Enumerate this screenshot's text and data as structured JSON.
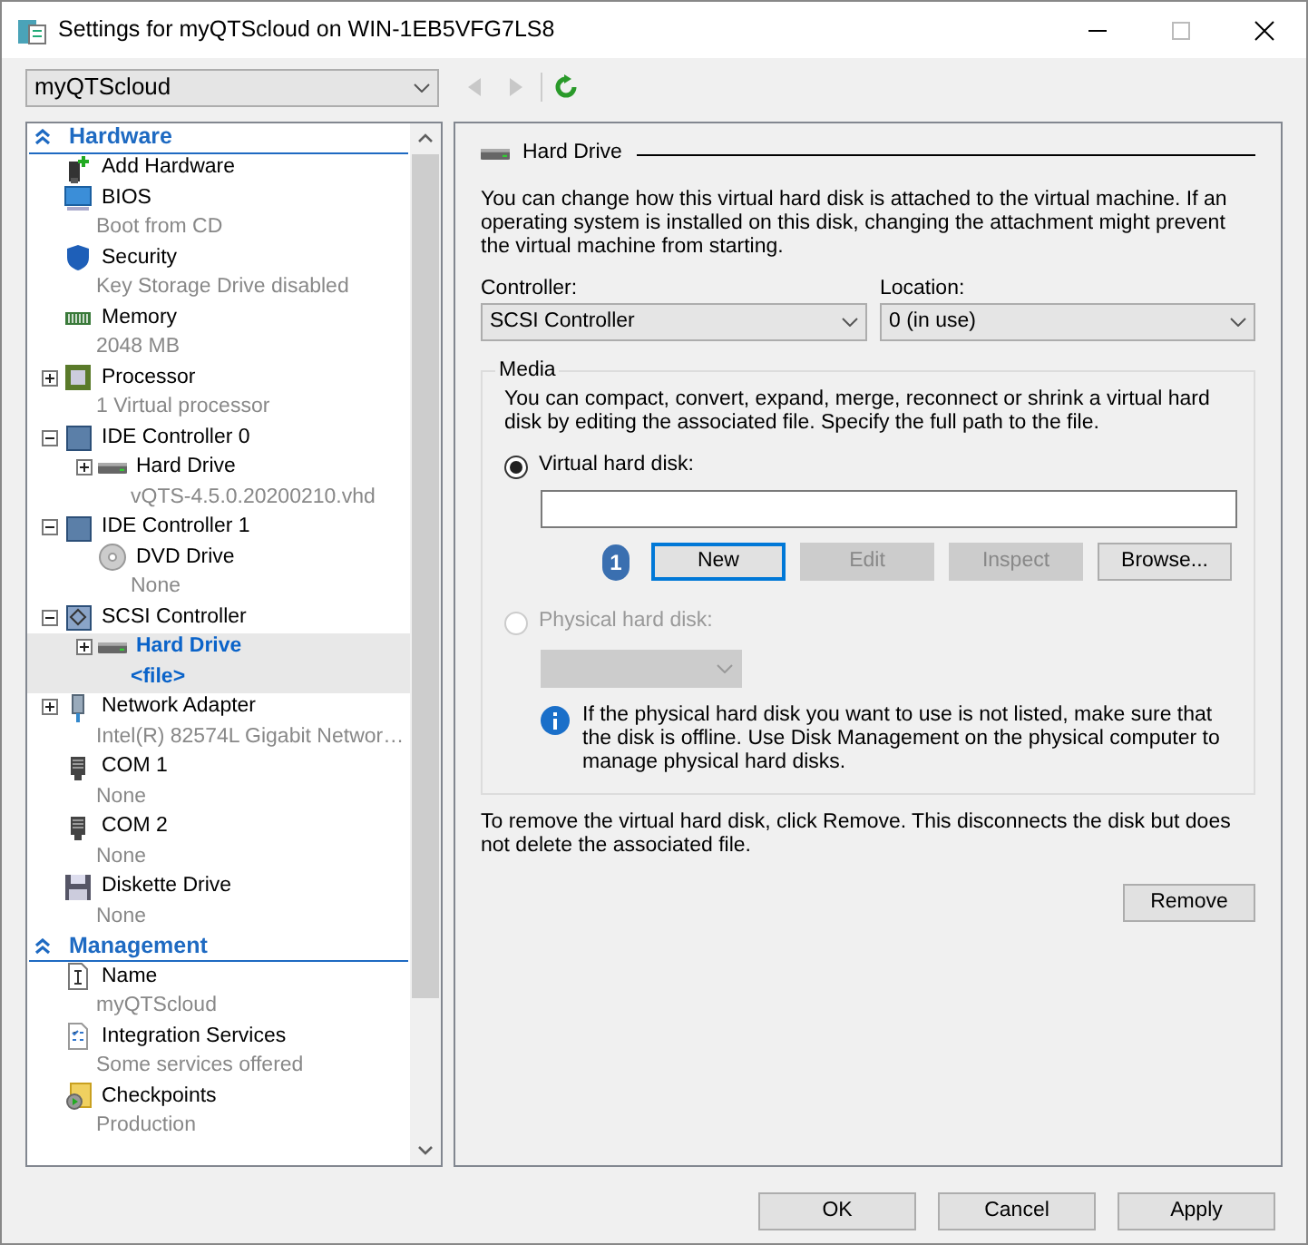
{
  "window": {
    "title": "Settings for myQTScloud on WIN-1EB5VFG7LS8"
  },
  "vm_selector": {
    "value": "myQTScloud"
  },
  "sections": [
    {
      "title": "Hardware",
      "expanded": true,
      "items": [
        {
          "kind": "add-hardware",
          "label": "Add Hardware",
          "selected": false
        },
        {
          "kind": "bios",
          "label": "BIOS",
          "detail": "Boot from CD",
          "selected": false
        },
        {
          "kind": "security",
          "label": "Security",
          "detail": "Key Storage Drive disabled",
          "selected": false
        },
        {
          "kind": "memory",
          "label": "Memory",
          "detail": "2048 MB",
          "selected": false
        },
        {
          "kind": "processor",
          "label": "Processor",
          "detail": "1 Virtual processor",
          "expanded": false,
          "selected": false
        },
        {
          "kind": "ide",
          "label": "IDE Controller 0",
          "expanded": true,
          "selected": false,
          "children": [
            {
              "kind": "hard-drive",
              "label": "Hard Drive",
              "detail": "vQTS-4.5.0.20200210.vhd",
              "expanded": false,
              "selected": false
            }
          ]
        },
        {
          "kind": "ide",
          "label": "IDE Controller 1",
          "expanded": true,
          "selected": false,
          "children": [
            {
              "kind": "dvd",
              "label": "DVD Drive",
              "detail": "None",
              "selected": false
            }
          ]
        },
        {
          "kind": "scsi",
          "label": "SCSI Controller",
          "expanded": true,
          "selected": false,
          "children": [
            {
              "kind": "hard-drive",
              "label": "Hard Drive",
              "detail": "<file>",
              "expanded": false,
              "selected": true
            }
          ]
        },
        {
          "kind": "network",
          "label": "Network Adapter",
          "detail": "Intel(R) 82574L Gigabit Networ…",
          "expanded": false,
          "selected": false
        },
        {
          "kind": "com",
          "label": "COM 1",
          "detail": "None",
          "selected": false
        },
        {
          "kind": "com",
          "label": "COM 2",
          "detail": "None",
          "selected": false
        },
        {
          "kind": "diskette",
          "label": "Diskette Drive",
          "detail": "None",
          "selected": false
        }
      ]
    },
    {
      "title": "Management",
      "expanded": true,
      "items": [
        {
          "kind": "name",
          "label": "Name",
          "detail": "myQTScloud",
          "selected": false
        },
        {
          "kind": "integration",
          "label": "Integration Services",
          "detail": "Some services offered",
          "selected": false
        },
        {
          "kind": "checkpoints",
          "label": "Checkpoints",
          "detail": "Production",
          "selected": false
        }
      ]
    }
  ],
  "panel": {
    "title": "Hard Drive",
    "description": "You can change how this virtual hard disk is attached to the virtual machine. If an operating system is installed on this disk, changing the attachment might prevent the virtual machine from starting.",
    "controller": {
      "label": "Controller:",
      "value": "SCSI Controller"
    },
    "location": {
      "label": "Location:",
      "value": "0 (in use)"
    },
    "media": {
      "title": "Media",
      "description": "You can compact, convert, expand, merge, reconnect or shrink a virtual hard disk by editing the associated file. Specify the full path to the file.",
      "options": [
        {
          "kind": "file",
          "label": "Virtual hard disk:",
          "selected": true,
          "disabled": false,
          "callout": "1",
          "buttons": [
            {
              "label": "New",
              "focused": true,
              "disabled": false
            },
            {
              "label": "Edit",
              "focused": false,
              "disabled": true
            },
            {
              "label": "Inspect",
              "focused": false,
              "disabled": true
            },
            {
              "label": "Browse...",
              "focused": false,
              "disabled": false
            }
          ]
        },
        {
          "kind": "device",
          "label": "Physical hard disk:",
          "selected": false,
          "disabled": true,
          "info": "If the physical hard disk you want to use is not listed, make sure that the disk is offline. Use Disk Management on the physical computer to manage physical hard disks."
        }
      ]
    },
    "remove_text": "To remove the virtual hard disk, click Remove. This disconnects the disk but does not delete the associated file.",
    "remove_button": "Remove"
  },
  "footer_buttons": [
    "OK",
    "Cancel",
    "Apply"
  ]
}
